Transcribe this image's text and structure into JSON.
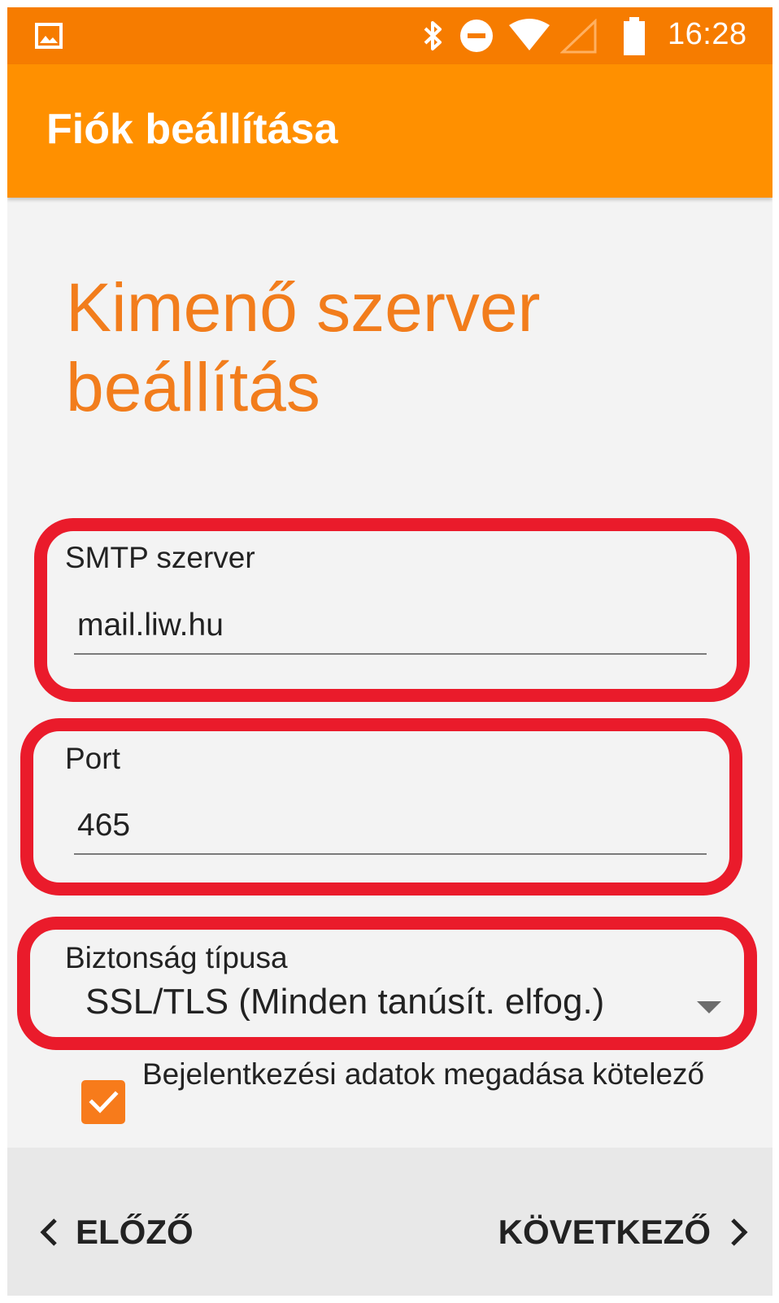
{
  "status_bar": {
    "time": "16:28",
    "icons": [
      "gallery-icon",
      "bluetooth-icon",
      "do-not-disturb-icon",
      "wifi-icon",
      "cell-signal-icon",
      "battery-icon"
    ]
  },
  "app_bar": {
    "title": "Fiók beállítása"
  },
  "page": {
    "heading": "Kimenő szerver beállítás"
  },
  "fields": {
    "smtp": {
      "label": "SMTP szerver",
      "value": "mail.liw.hu"
    },
    "port": {
      "label": "Port",
      "value": "465"
    },
    "security": {
      "label": "Biztonság típusa",
      "selected": "SSL/TLS (Minden tanúsít. elfog.)"
    }
  },
  "checkbox": {
    "label": "Bejelentkezési adatok megadása kötelező",
    "checked": true
  },
  "nav": {
    "prev_label": "ELŐZŐ",
    "next_label": "KÖVETKEZŐ"
  },
  "colors": {
    "status_bar": "#f67c00",
    "app_bar": "#ff9000",
    "accent": "#f27d1c",
    "highlight": "#ea1b2b",
    "background": "#f3f3f3"
  }
}
